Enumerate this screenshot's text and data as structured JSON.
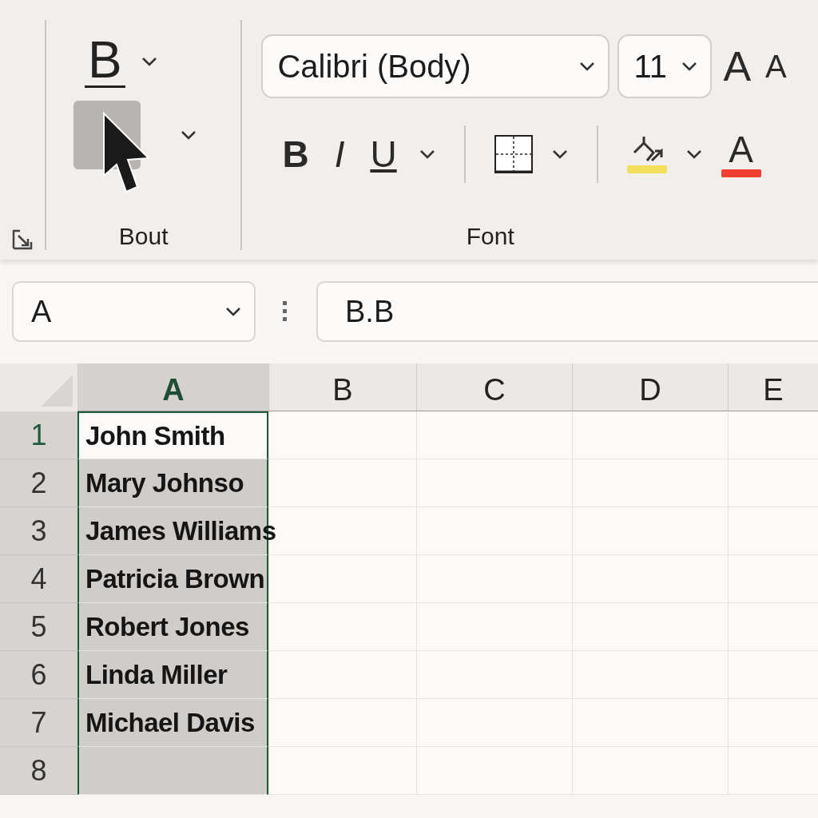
{
  "ribbon": {
    "groups": [
      {
        "kind": "bout",
        "label": "Bout",
        "top_button": {
          "glyph": "B"
        },
        "fill_button": {
          "selected": true
        }
      },
      {
        "kind": "font",
        "label": "Font",
        "font_name": "Calibri (Body)",
        "font_size": "11",
        "grow_font": "A",
        "shrink_font": "A",
        "styles": [
          {
            "glyph": "B",
            "kind": "bold"
          },
          {
            "glyph": "I",
            "kind": "italic"
          },
          {
            "glyph": "U",
            "kind": "underline"
          }
        ],
        "fill_color": {
          "color": "#f2df5c"
        },
        "font_color": {
          "glyph": "A",
          "color": "#f04034"
        }
      }
    ]
  },
  "formula_bar": {
    "name_box": "A",
    "value": "B.B"
  },
  "sheet": {
    "columns": [
      {
        "label": "A",
        "selected": true
      },
      {
        "label": "B",
        "selected": false
      },
      {
        "label": "C",
        "selected": false
      },
      {
        "label": "D",
        "selected": false
      },
      {
        "label": "E",
        "selected": false
      }
    ],
    "rows": [
      {
        "number": "1",
        "active": true,
        "value": "John Smith"
      },
      {
        "number": "2",
        "active": false,
        "value": "Mary Johnso"
      },
      {
        "number": "3",
        "active": false,
        "value": "James Williams"
      },
      {
        "number": "4",
        "active": false,
        "value": "Patricia Brown"
      },
      {
        "number": "5",
        "active": false,
        "value": "Robert Jones"
      },
      {
        "number": "6",
        "active": false,
        "value": "Linda Miller"
      },
      {
        "number": "7",
        "active": false,
        "value": "Michael Davis"
      },
      {
        "number": "8",
        "active": false,
        "value": ""
      }
    ]
  }
}
